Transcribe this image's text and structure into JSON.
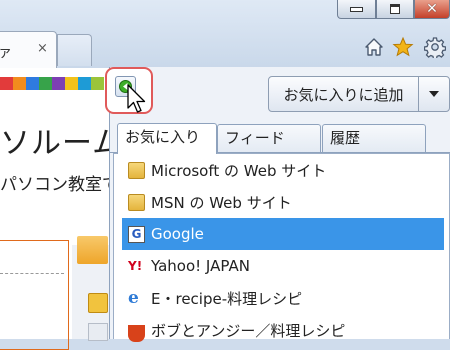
{
  "browser": {
    "tab": {
      "label": "ァ",
      "close_glyph": "×"
    },
    "window_buttons": [
      "minimize",
      "maximize",
      "close"
    ],
    "toolbar_icons": [
      "home-icon",
      "star-icon",
      "gear-icon"
    ],
    "colors": {
      "chrome": "#cfdcec",
      "close": "#c4402a",
      "star": "#f2b418"
    }
  },
  "page": {
    "heading": "ソルーム",
    "subheading": "パソコン教室で",
    "swatch_colors": [
      "#e23b3b",
      "#f28c1e",
      "#2f7be0",
      "#37a34a",
      "#7d3fb3",
      "#f2c21a",
      "#1e9bd6",
      "#9bc43a"
    ]
  },
  "favorites_button": {
    "icon": "favorites-green-arrow-icon"
  },
  "favorites_panel": {
    "add_button_label": "お気に入りに追加",
    "tabs": [
      {
        "label": "お気に入り",
        "active": true
      },
      {
        "label": "フィード",
        "active": false
      },
      {
        "label": "履歴",
        "active": false
      }
    ],
    "items": [
      {
        "label": "Microsoft の Web サイト",
        "icon": "folder-icon",
        "selected": false
      },
      {
        "label": "MSN の Web サイト",
        "icon": "folder-icon",
        "selected": false
      },
      {
        "label": "Google",
        "icon": "google-icon",
        "selected": true
      },
      {
        "label": "Yahoo! JAPAN",
        "icon": "yahoo-icon",
        "selected": false
      },
      {
        "label": "E・recipe-料理レシピ",
        "icon": "ie-page-icon",
        "selected": false
      },
      {
        "label": "ボブとアンジー／料理レシピ",
        "icon": "pot-icon",
        "selected": false
      }
    ],
    "colors": {
      "selected": "#3a95e8",
      "highlight_ring": "#e05a5a"
    }
  }
}
